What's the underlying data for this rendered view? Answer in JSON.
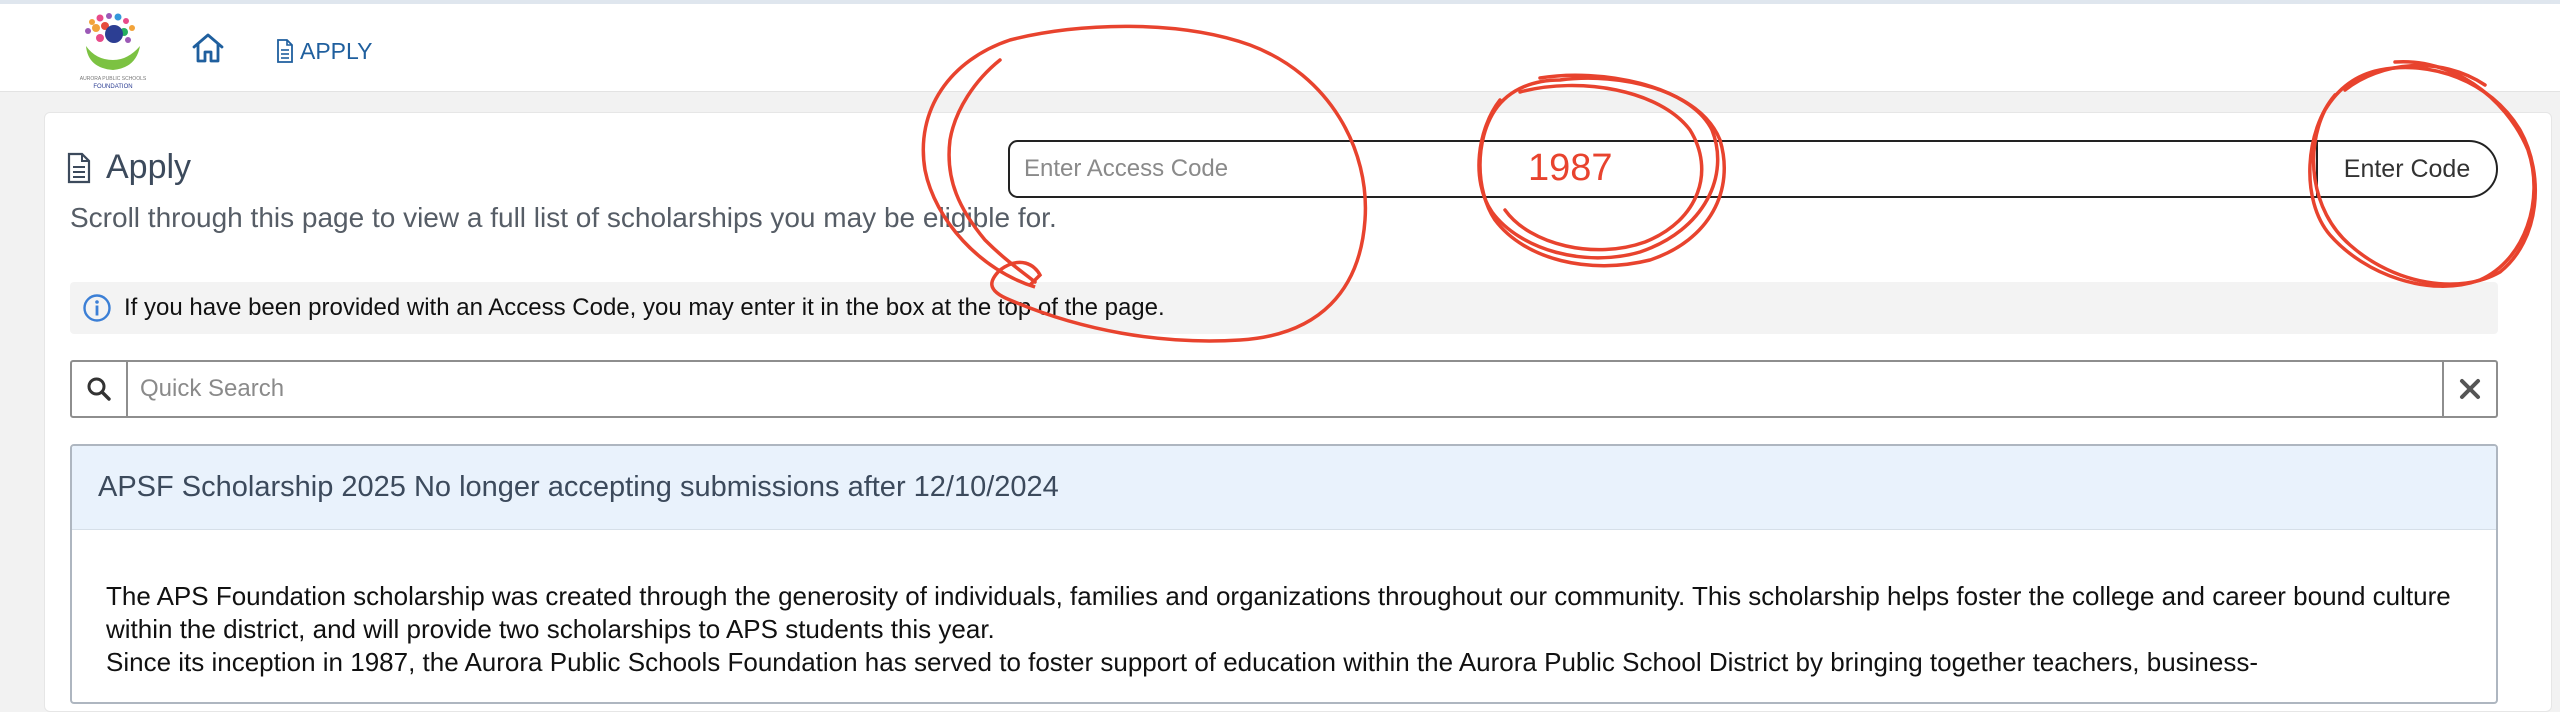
{
  "nav": {
    "logo_text": "AURORA PUBLIC SCHOOLS FOUNDATION",
    "apply_label": "APPLY"
  },
  "page": {
    "title": "Apply",
    "subtitle": "Scroll through this page to view a full list of scholarships you may be eligible for."
  },
  "access_code": {
    "placeholder": "Enter Access Code",
    "button_label": "Enter Code"
  },
  "info": {
    "text": "If you have been provided with an Access Code, you may enter it in the box at the top of the page."
  },
  "search": {
    "placeholder": "Quick Search"
  },
  "scholarship": {
    "header": "APSF Scholarship 2025 No longer accepting submissions after 12/10/2024",
    "paragraph1": "The APS Foundation scholarship was created through the generosity of individuals, families and organizations throughout our community. This scholarship helps foster the college and career bound culture within the district, and will provide two scholarships to APS students this year.",
    "paragraph2": "Since its inception in 1987, the Aurora Public Schools Foundation has served to foster support of education within the Aurora Public School District by bringing together teachers, business-"
  },
  "annotation": {
    "handwritten_value": "1987",
    "color": "#e8432e"
  },
  "colors": {
    "link": "#1f5f9e",
    "info_icon": "#3b7fd6",
    "header_bg": "#e9f2fc"
  }
}
